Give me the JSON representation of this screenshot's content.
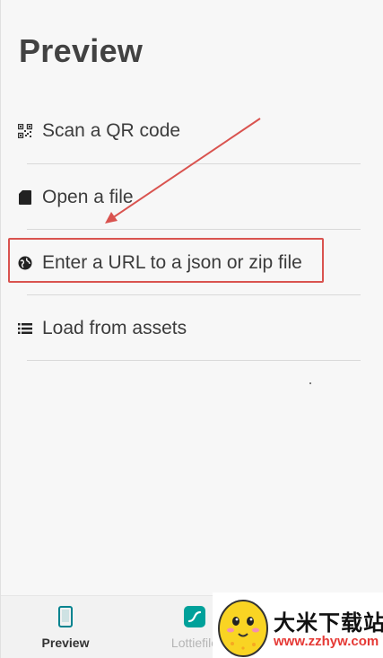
{
  "header": {
    "title": "Preview"
  },
  "menu": {
    "items": [
      {
        "label": "Scan a QR code",
        "icon": "qr-code-icon"
      },
      {
        "label": "Open a file",
        "icon": "sd-card-icon"
      },
      {
        "label": "Enter a URL to a json or zip file",
        "icon": "globe-icon"
      },
      {
        "label": "Load from assets",
        "icon": "list-icon"
      }
    ]
  },
  "bottom_nav": {
    "items": [
      {
        "label": "Preview",
        "icon": "phone-icon",
        "active": true
      },
      {
        "label": "Lottiefile",
        "icon": "lottiefiles-icon",
        "active": false
      }
    ]
  },
  "watermark": {
    "brand": "大米下载站",
    "url": "www.zzhyw.com"
  },
  "colors": {
    "highlight": "#d9534f",
    "lottie_brand": "#00a19a",
    "nav_active": "#00838f"
  }
}
